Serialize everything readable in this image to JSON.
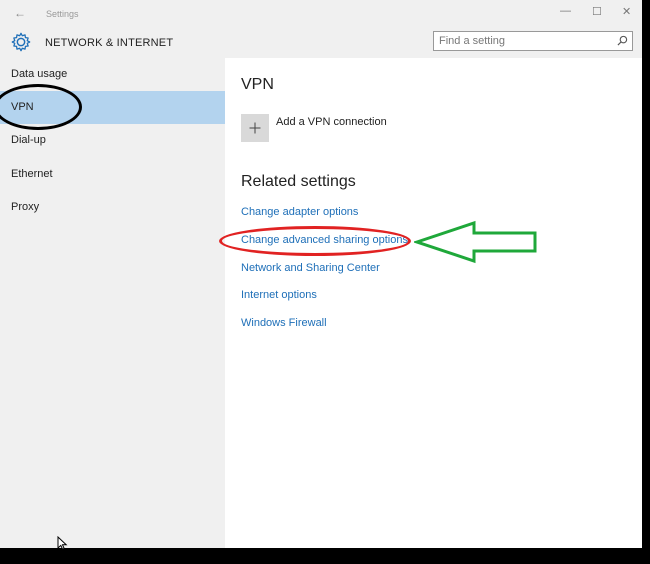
{
  "window": {
    "title": "Settings",
    "minimize": "—",
    "maximize": "☐",
    "close": "✕",
    "back": "←"
  },
  "header": {
    "title": "NETWORK & INTERNET",
    "search_placeholder": "Find a setting",
    "icon": "gear-icon"
  },
  "sidebar": {
    "items": [
      {
        "label": "Data usage",
        "selected": false
      },
      {
        "label": "VPN",
        "selected": true
      },
      {
        "label": "Dial-up",
        "selected": false
      },
      {
        "label": "Ethernet",
        "selected": false
      },
      {
        "label": "Proxy",
        "selected": false
      }
    ]
  },
  "main": {
    "vpn_title": "VPN",
    "add_vpn_label": "Add a VPN connection",
    "related_title": "Related settings",
    "links": [
      "Change adapter options",
      "Change advanced sharing options",
      "Network and Sharing Center",
      "Internet options",
      "Windows Firewall"
    ]
  },
  "colors": {
    "accent_link": "#1e6fb8",
    "selected_bg": "#b3d3ee",
    "annotation_red": "#e12222",
    "annotation_green": "#1fa83a",
    "annotation_black": "#000000"
  }
}
